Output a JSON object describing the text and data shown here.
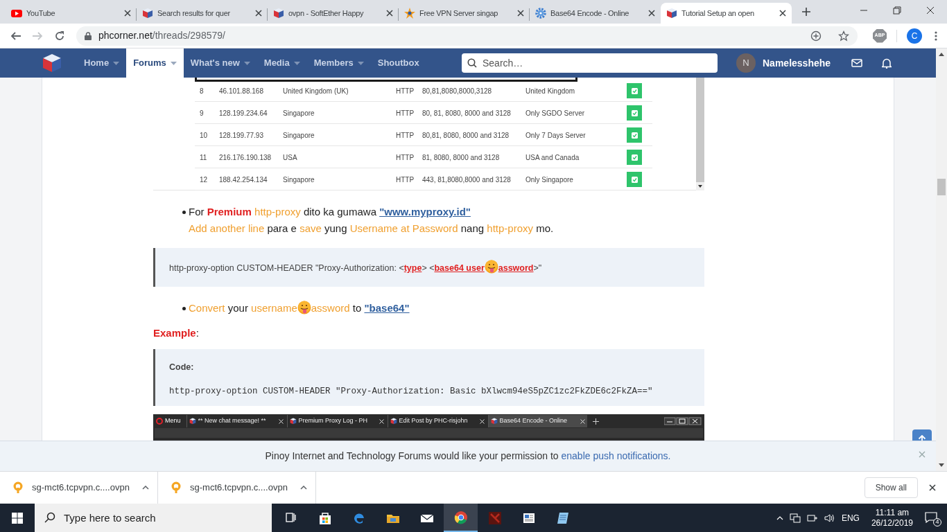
{
  "browser_tabs": [
    {
      "title": "YouTube",
      "kind": "youtube",
      "selected": false
    },
    {
      "title": "Search results for quer",
      "kind": "cube",
      "selected": false
    },
    {
      "title": "ovpn - SoftEther Happy",
      "kind": "cube",
      "selected": false
    },
    {
      "title": "Free VPN Server singap",
      "kind": "star",
      "selected": false
    },
    {
      "title": "Base64 Encode - Online",
      "kind": "gear",
      "selected": false
    },
    {
      "title": "Tutorial Setup an open",
      "kind": "cube",
      "selected": true
    }
  ],
  "address": {
    "host": "phcorner.net",
    "path": "/threads/298579/"
  },
  "extension": "ABP",
  "profile": "C",
  "site_nav": {
    "items": [
      {
        "label": "Home",
        "selected": false,
        "caret": true
      },
      {
        "label": "Forums",
        "selected": true,
        "caret": true
      },
      {
        "label": "What's new",
        "selected": false,
        "caret": true
      },
      {
        "label": "Media",
        "selected": false,
        "caret": true
      },
      {
        "label": "Members",
        "selected": false,
        "caret": true
      },
      {
        "label": "Shoutbox",
        "selected": false,
        "caret": false
      }
    ],
    "search_placeholder": "Search…",
    "user": {
      "initial": "N",
      "name": "Namelesshehe"
    }
  },
  "post": {
    "table_image": {
      "rows": [
        {
          "cells": [
            "8",
            "46.101.88.168",
            "United Kingdom (UK)",
            "HTTP",
            "80,81,8080,8000,3128",
            "United Kingdom"
          ],
          "checked": true
        },
        {
          "cells": [
            "9",
            "128.199.234.64",
            "Singapore",
            "HTTP",
            "80, 81, 8080, 8000 and 3128",
            "Only SGDO Server"
          ],
          "checked": true
        },
        {
          "cells": [
            "10",
            "128.199.77.93",
            "Singapore",
            "HTTP",
            "80,81, 8080, 8000 and 3128",
            "Only 7 Days Server"
          ],
          "checked": true
        },
        {
          "cells": [
            "11",
            "216.176.190.138",
            "USA",
            "HTTP",
            "81, 8080, 8000 and 3128",
            "USA and Canada"
          ],
          "checked": true
        },
        {
          "cells": [
            "12",
            "188.42.254.134",
            "Singapore",
            "HTTP",
            "443, 81,8080,8000 and 3128",
            "Only Singapore"
          ],
          "checked": true
        }
      ]
    },
    "blocks": [
      {
        "kind": "bullet",
        "lines": [
          [
            {
              "kind": "plain",
              "text": "For "
            },
            {
              "kind": "strong",
              "text": "Premium"
            },
            {
              "kind": "highlight",
              "text": " http-proxy"
            },
            {
              "kind": "plain",
              "text": " dito ka gumawa "
            },
            {
              "kind": "link",
              "text": "\"www.myproxy.id\""
            }
          ],
          [
            {
              "kind": "highlight",
              "text": "Add another line"
            },
            {
              "kind": "plain",
              "text": " para e "
            },
            {
              "kind": "highlight",
              "text": "save"
            },
            {
              "kind": "plain",
              "text": " yung "
            },
            {
              "kind": "highlight",
              "text": "Username at Password"
            },
            {
              "kind": "plain",
              "text": " nang "
            },
            {
              "kind": "highlight",
              "text": "http-proxy"
            },
            {
              "kind": "plain",
              "text": " mo."
            }
          ]
        ]
      },
      {
        "kind": "quote",
        "lines": [
          [
            {
              "kind": "plain",
              "text": "http-proxy-option CUSTOM-HEADER \"Proxy-Authorization: <"
            },
            {
              "kind": "red_link",
              "text": "type"
            },
            {
              "kind": "plain",
              "text": "> <"
            },
            {
              "kind": "red_link",
              "text": "base64 user"
            },
            {
              "kind": "emoji"
            },
            {
              "kind": "red_link",
              "text": "assword"
            },
            {
              "kind": "plain",
              "text": ">\""
            }
          ]
        ]
      },
      {
        "kind": "bullet",
        "lines": [
          [
            {
              "kind": "highlight",
              "text": "Convert"
            },
            {
              "kind": "plain",
              "text": " your "
            },
            {
              "kind": "highlight",
              "text": "username"
            },
            {
              "kind": "emoji"
            },
            {
              "kind": "highlight",
              "text": "assword"
            },
            {
              "kind": "plain",
              "text": " to "
            },
            {
              "kind": "link",
              "text": "\"base64\""
            }
          ]
        ]
      },
      {
        "kind": "heading",
        "lines": [
          [
            {
              "kind": "strong",
              "text": "Example"
            },
            {
              "kind": "plain",
              "text": ":"
            }
          ]
        ]
      },
      {
        "kind": "code",
        "title": "Code:",
        "text": "http-proxy-option CUSTOM-HEADER \"Proxy-Authorization: Basic bXlwcm94eS5pZC1zc2FkZDE6c2FkZA==\""
      },
      {
        "kind": "screenshot",
        "menu": "Menu",
        "tabs": [
          {
            "title": "** New chat message! **",
            "selected": false
          },
          {
            "title": "Premium Proxy Log - PH",
            "selected": false
          },
          {
            "title": "Edit Post by PHC-risjohn",
            "selected": false
          },
          {
            "title": "Base64 Encode - Online",
            "selected": true
          }
        ]
      }
    ]
  },
  "notification": {
    "text": "Pinoy Internet and Technology Forums would like your permission to ",
    "link": "enable push notifications."
  },
  "downloads": {
    "items": [
      {
        "file": "sg-mct6.tcpvpn.c....ovpn"
      },
      {
        "file": "sg-mct6.tcpvpn.c....ovpn"
      }
    ],
    "show_all": "Show all"
  },
  "taskbar": {
    "search_placeholder": "Type here to search",
    "apps": [
      {
        "kind": "taskview",
        "selected": false
      },
      {
        "kind": "store",
        "selected": false
      },
      {
        "kind": "edge",
        "selected": false
      },
      {
        "kind": "explorer",
        "selected": false
      },
      {
        "kind": "mail",
        "selected": false
      },
      {
        "kind": "chrome",
        "selected": true
      },
      {
        "kind": "game",
        "selected": false
      },
      {
        "kind": "document",
        "selected": false
      },
      {
        "kind": "notepad",
        "selected": false
      }
    ],
    "language": "ENG",
    "time": "11:11 am",
    "date": "26/12/2019",
    "notifications": "4"
  }
}
